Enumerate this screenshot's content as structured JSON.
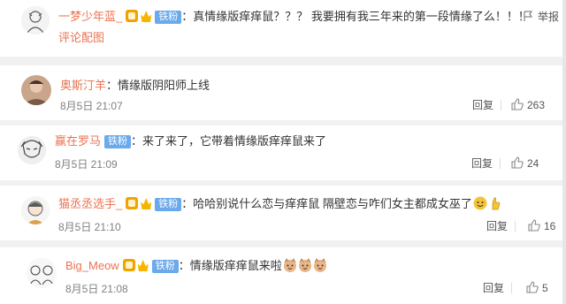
{
  "comments": [
    {
      "username": "一梦少年蓝_",
      "fan_badge": "铁粉",
      "colon": "：",
      "text": "真情缘版痒痒鼠？？？ 我要拥有我三年来的第一段情缘了么！！！",
      "report_label": "举报",
      "attachment_label": "评论配图"
    },
    {
      "username": "奥斯汀羊",
      "colon": "：",
      "text": "情缘版阴阳师上线",
      "time": "8月5日 21:07",
      "reply_label": "回复",
      "likes": "263"
    },
    {
      "username": "赢在罗马",
      "fan_badge": "铁粉",
      "colon": "：",
      "text": "来了来了，它带着情缘版痒痒鼠来了",
      "time": "8月5日 21:09",
      "reply_label": "回复",
      "likes": "24"
    },
    {
      "username": "猫丞丞选手_",
      "fan_badge": "铁粉",
      "colon": "：",
      "text": "哈哈别说什么恋与痒痒鼠 隔壁恋与咋们女主都成女巫了",
      "time": "8月5日 21:10",
      "reply_label": "回复",
      "likes": "16"
    },
    {
      "username": "Big_Meow",
      "fan_badge": "铁粉",
      "colon": "：",
      "text": "情缘版痒痒鼠来啦",
      "time": "8月5日 21:08",
      "reply_label": "回复",
      "likes": "5"
    }
  ],
  "colors": {
    "username": "#eb7350",
    "fan_badge_bg": "#6aa9ea",
    "meta_text": "#808080",
    "page_bg": "#f1f1f1"
  },
  "icons": [
    "report-icon",
    "thumbs-up-icon",
    "vip-badge-icon",
    "crown-badge-icon",
    "emoji-icon"
  ]
}
